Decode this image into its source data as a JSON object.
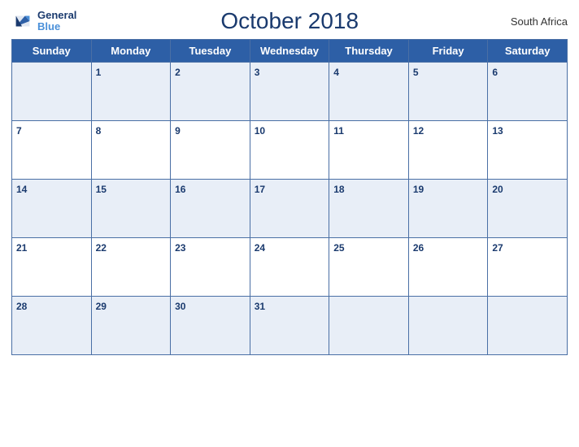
{
  "header": {
    "logo_text_line1": "General",
    "logo_text_line2": "Blue",
    "title": "October 2018",
    "country": "South Africa"
  },
  "days_of_week": [
    "Sunday",
    "Monday",
    "Tuesday",
    "Wednesday",
    "Thursday",
    "Friday",
    "Saturday"
  ],
  "weeks": [
    [
      null,
      1,
      2,
      3,
      4,
      5,
      6
    ],
    [
      7,
      8,
      9,
      10,
      11,
      12,
      13
    ],
    [
      14,
      15,
      16,
      17,
      18,
      19,
      20
    ],
    [
      21,
      22,
      23,
      24,
      25,
      26,
      27
    ],
    [
      28,
      29,
      30,
      31,
      null,
      null,
      null
    ]
  ]
}
